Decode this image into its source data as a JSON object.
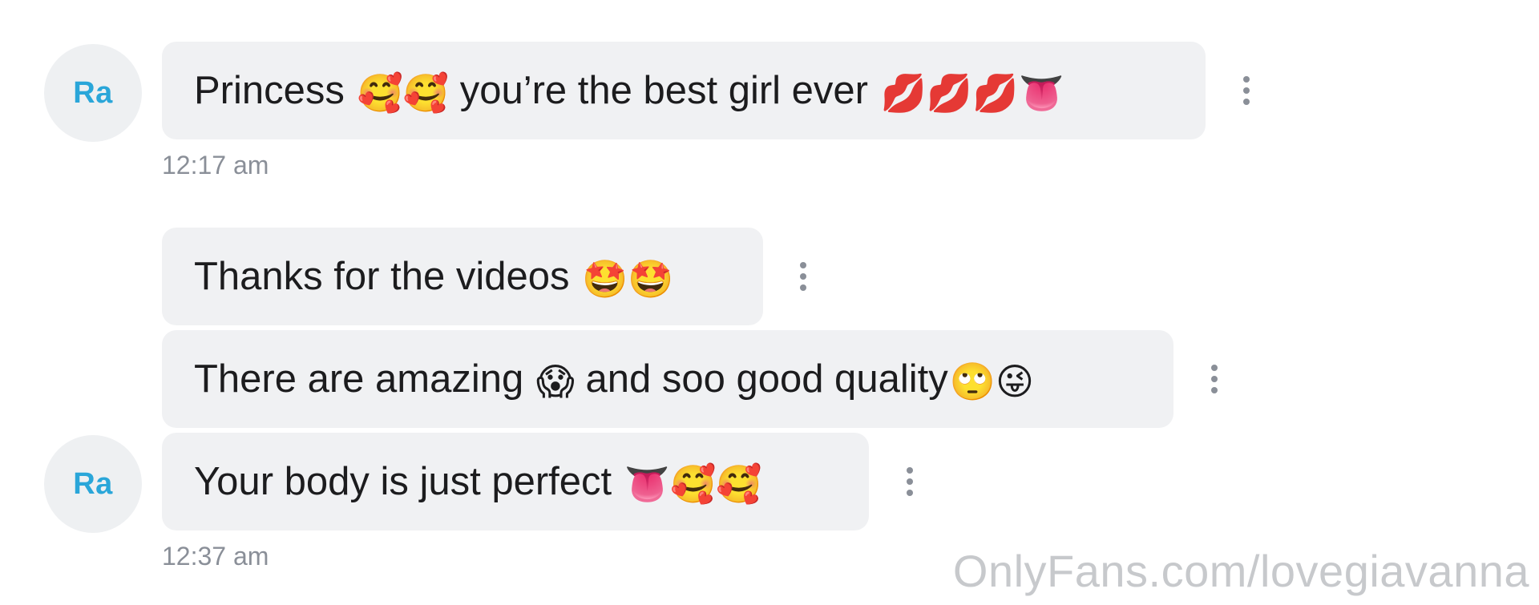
{
  "avatar_label": "Ra",
  "messages": [
    {
      "text": "Princess ",
      "emoji_mid": "🥰🥰",
      "text2": " you’re the best girl ever ",
      "emoji_end": "💋💋💋👅"
    },
    {
      "text": "Thanks for the videos ",
      "emoji_end": "🤩🤩"
    },
    {
      "text": "There are amazing ",
      "emoji_mid": "😱",
      "text2": " and soo good quality",
      "emoji_end": "🙄😜"
    },
    {
      "text": "Your body is just perfect ",
      "emoji_end": "👅🥰🥰"
    }
  ],
  "timestamps": [
    "12:17 am",
    "12:37 am"
  ],
  "watermark": "OnlyFans.com/lovegiavanna",
  "colors": {
    "avatar_text": "#2aa6d9",
    "avatar_bg": "#eef0f2",
    "bubble_bg": "#f0f1f3",
    "timestamp": "#8a8f98",
    "watermark": "#c7c9cc"
  },
  "icons": {
    "message_menu": "vertical-ellipsis-icon"
  }
}
